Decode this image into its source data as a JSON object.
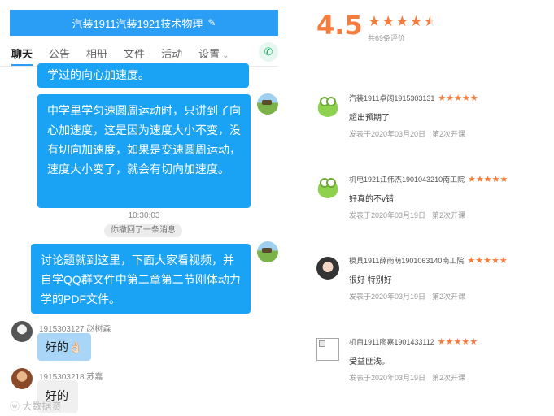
{
  "chat": {
    "title": "汽装1911汽装1921技术物理",
    "tabs": [
      "聊天",
      "公告",
      "相册",
      "文件",
      "活动",
      "设置"
    ],
    "messages": {
      "partial": "学过的向心加速度。",
      "m1": "中学里学匀速圆周运动时，只讲到了向心加速度，这是因为速度大小不变，没有切向加速度，如果是变速圆周运动，速度大小变了，就会有切向加速度。",
      "time": "10:30:03",
      "recall": "你撤回了一条消息",
      "m2": "讨论题就到这里，下面大家看视频，并自学QQ群文件中第二章第二节刚体动力学的PDF文件。",
      "sender1": "1915303127 赵树森",
      "reply1": "好的👌🏻",
      "sender2": "1915303218 苏嘉",
      "reply2": "好的"
    },
    "watermark": "大数据资"
  },
  "reviews": {
    "score": "4.5",
    "count": "共69条评价",
    "items": [
      {
        "name": "汽装1911卓阔1915303131",
        "text": "超出预期了",
        "date": "发表于2020年03月20日",
        "round": "第2次开课"
      },
      {
        "name": "机电1921江伟杰1901043210南工院",
        "text": "好真的不v错",
        "date": "发表于2020年03月19日",
        "round": "第2次开课"
      },
      {
        "name": "模具1911薛雨萌1901063140南工院",
        "text": "很好 特别好",
        "date": "发表于2020年03月19日",
        "round": "第2次开课"
      },
      {
        "name": "机自1911廖嘉1901433112",
        "text": "受益匪浅。",
        "date": "发表于2020年03月19日",
        "round": "第2次开课"
      }
    ]
  }
}
